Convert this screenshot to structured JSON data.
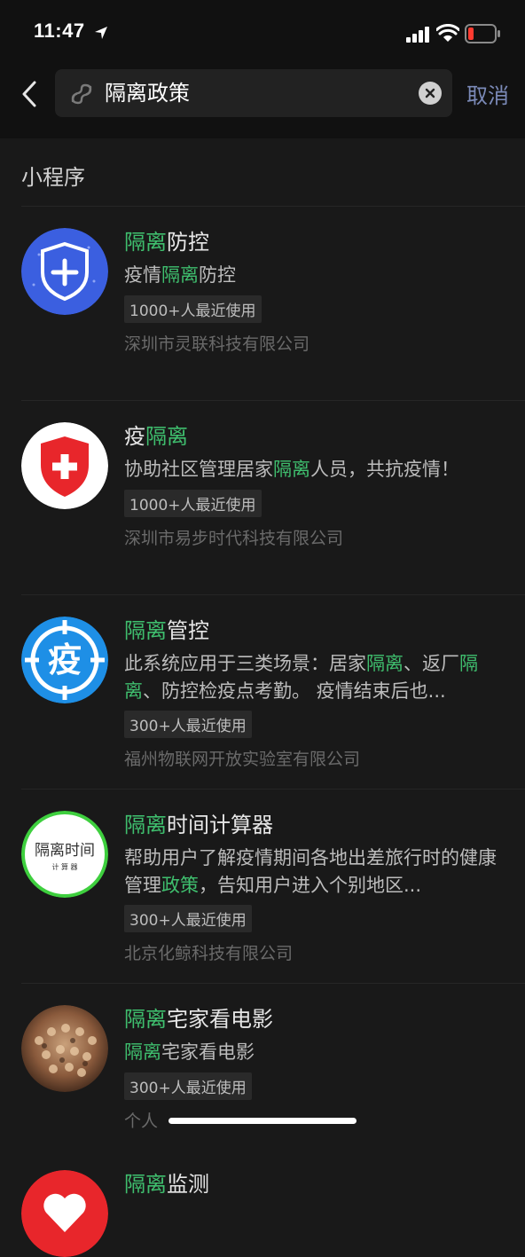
{
  "status_bar": {
    "time": "11:47"
  },
  "search": {
    "query": "隔离政策",
    "cancel_label": "取消"
  },
  "section": {
    "title": "小程序"
  },
  "results": [
    {
      "title_parts": [
        {
          "t": "隔离",
          "hl": true
        },
        {
          "t": "防控",
          "hl": false
        }
      ],
      "desc_parts": [
        {
          "t": "疫情",
          "hl": false
        },
        {
          "t": "隔离",
          "hl": true
        },
        {
          "t": "防控",
          "hl": false
        }
      ],
      "usage": "1000+人最近使用",
      "company": "深圳市灵联科技有限公司",
      "icon": "shield-plus-icon",
      "color": "#3b5fe0"
    },
    {
      "title_parts": [
        {
          "t": "疫",
          "hl": false
        },
        {
          "t": "隔离",
          "hl": true
        }
      ],
      "desc_parts": [
        {
          "t": "协助社区管理居家",
          "hl": false
        },
        {
          "t": "隔离",
          "hl": true
        },
        {
          "t": "人员，共抗疫情！",
          "hl": false
        }
      ],
      "usage": "1000+人最近使用",
      "company": "深圳市易步时代科技有限公司",
      "icon": "red-shield-cross-icon",
      "color": "#e8262b"
    },
    {
      "title_parts": [
        {
          "t": "隔离",
          "hl": true
        },
        {
          "t": "管控",
          "hl": false
        }
      ],
      "desc_parts": [
        {
          "t": "此系统应用于三类场景：居家",
          "hl": false
        },
        {
          "t": "隔离",
          "hl": true
        },
        {
          "t": "、返厂",
          "hl": false
        },
        {
          "t": "隔离",
          "hl": true
        },
        {
          "t": "、防控检疫点考勤。 疫情结束后也...",
          "hl": false
        }
      ],
      "usage": "300+人最近使用",
      "company": "福州物联网开放实验室有限公司",
      "icon": "epidemic-target-icon",
      "icon_text": "疫",
      "color": "#1e8fe6"
    },
    {
      "title_parts": [
        {
          "t": "隔离",
          "hl": true
        },
        {
          "t": "时间计算器",
          "hl": false
        }
      ],
      "desc_parts": [
        {
          "t": "帮助用户了解疫情期间各地出差旅行时的健康管理",
          "hl": false
        },
        {
          "t": "政策",
          "hl": true
        },
        {
          "t": "，告知用户进入个别地区...",
          "hl": false
        }
      ],
      "usage": "300+人最近使用",
      "company": "北京化鲸科技有限公司",
      "icon": "isolation-timer-logo-icon",
      "icon_text": "隔离时间",
      "icon_subtext": "计 算 器",
      "color": "#3ecf3e"
    },
    {
      "title_parts": [
        {
          "t": "隔离",
          "hl": true
        },
        {
          "t": "宅家看电影",
          "hl": false
        }
      ],
      "desc_parts": [
        {
          "t": "隔离",
          "hl": true
        },
        {
          "t": "宅家看电影",
          "hl": false
        }
      ],
      "usage": "300+人最近使用",
      "company": "个人",
      "icon": "crowd-photo-icon",
      "color": "#8a5a3c"
    }
  ],
  "partial_item": {
    "title_parts": [
      {
        "t": "隔离",
        "hl": true
      },
      {
        "t": "监测",
        "hl": false
      }
    ]
  },
  "colors": {
    "background": "#191919",
    "header": "#111111",
    "highlight": "#3fbf6e",
    "cancel": "#7b8ab8"
  }
}
